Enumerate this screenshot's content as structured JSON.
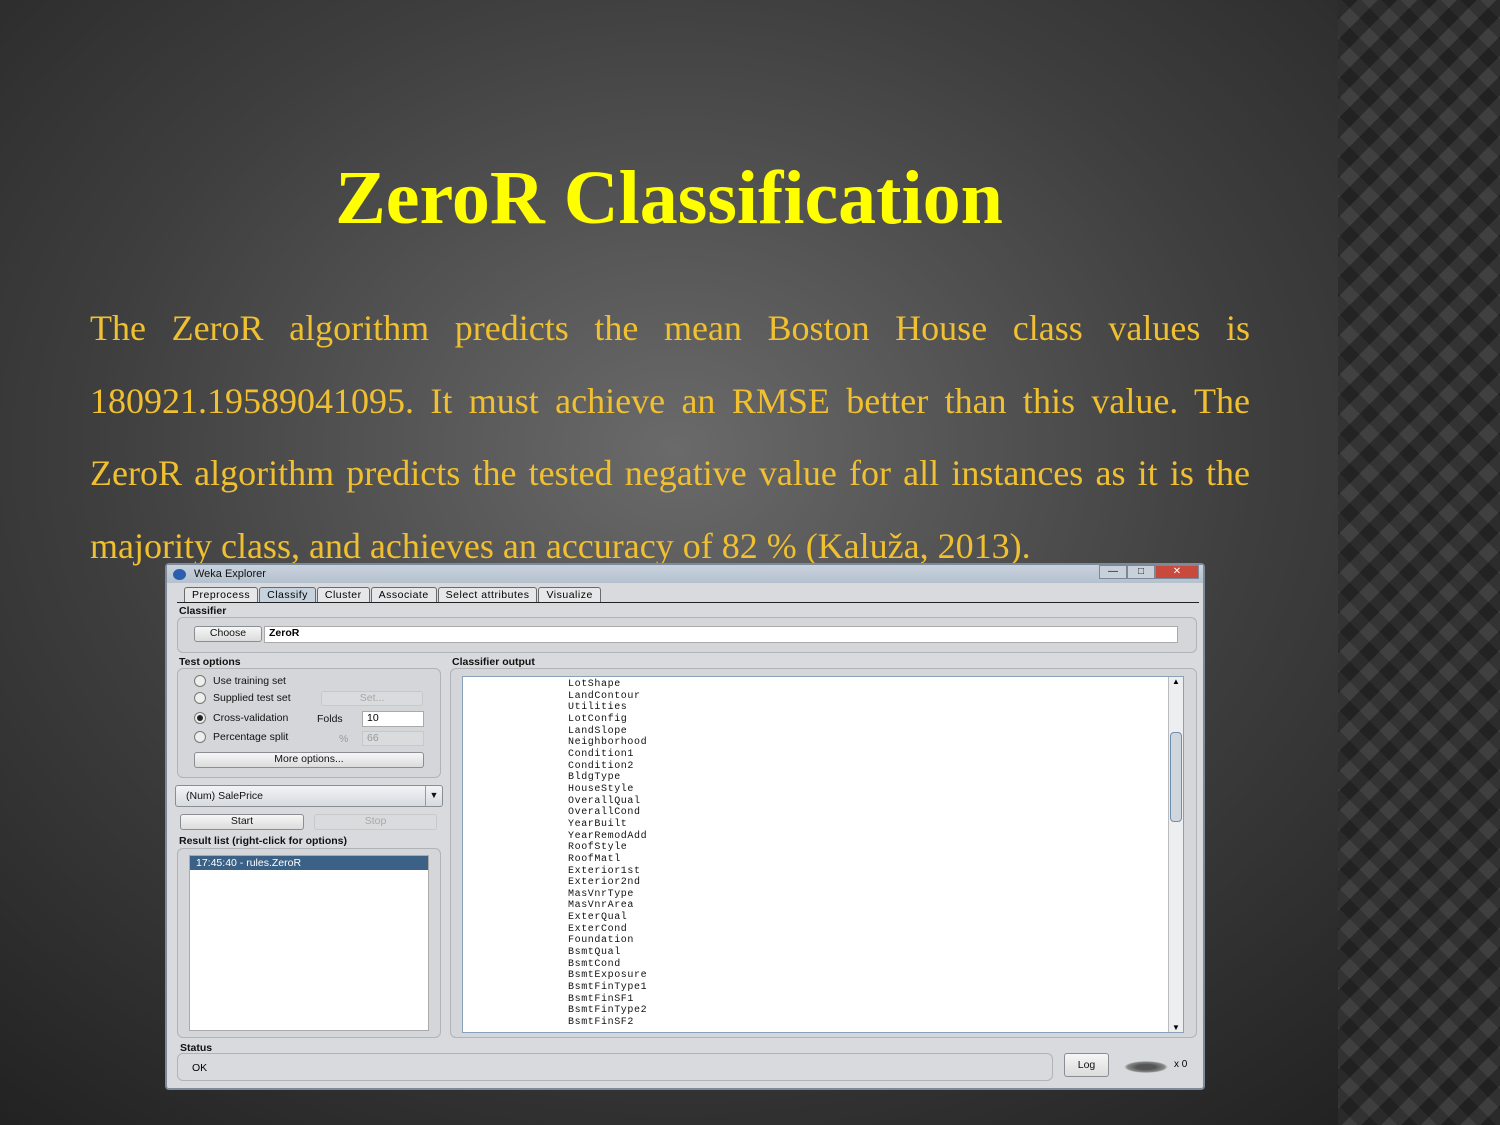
{
  "slide": {
    "title": "ZeroR  Classification",
    "paragraph": "The ZeroR algorithm predicts the mean Boston House class values is 180921.19589041095. It must achieve an RMSE better than this value. The ZeroR algorithm predicts the tested negative value for all instances as it is the majority class, and achieves an accuracy of 82 % (Kaluža, 2013).",
    "title_color": "#ffff00",
    "text_color": "#f0c030"
  },
  "window": {
    "title": "Weka Explorer",
    "minimize": "—",
    "maximize": "□",
    "close": "✕",
    "tabs": [
      "Preprocess",
      "Classify",
      "Cluster",
      "Associate",
      "Select attributes",
      "Visualize"
    ],
    "active_tab": "Classify",
    "classifier": {
      "label": "Classifier",
      "choose": "Choose",
      "value": "ZeroR"
    },
    "test_options": {
      "label": "Test options",
      "use_training": "Use training set",
      "supplied": "Supplied test set",
      "set_btn": "Set...",
      "cv": "Cross-validation",
      "folds_label": "Folds",
      "folds": "10",
      "split": "Percentage split",
      "pct_label": "%",
      "pct": "66",
      "more": "More options...",
      "selected": "Cross-validation"
    },
    "target": "(Num) SalePrice",
    "start": "Start",
    "stop": "Stop",
    "result_list": {
      "label": "Result list (right-click for options)",
      "items": [
        "17:45:40 - rules.ZeroR"
      ]
    },
    "output": {
      "label": "Classifier output",
      "lines": [
        "LotShape",
        "LandContour",
        "Utilities",
        "LotConfig",
        "LandSlope",
        "Neighborhood",
        "Condition1",
        "Condition2",
        "BldgType",
        "HouseStyle",
        "OverallQual",
        "OverallCond",
        "YearBuilt",
        "YearRemodAdd",
        "RoofStyle",
        "RoofMatl",
        "Exterior1st",
        "Exterior2nd",
        "MasVnrType",
        "MasVnrArea",
        "ExterQual",
        "ExterCond",
        "Foundation",
        "BsmtQual",
        "BsmtCond",
        "BsmtExposure",
        "BsmtFinType1",
        "BsmtFinSF1",
        "BsmtFinType2",
        "BsmtFinSF2"
      ]
    },
    "status": {
      "label": "Status",
      "text": "OK",
      "log": "Log",
      "count": "x 0"
    }
  }
}
